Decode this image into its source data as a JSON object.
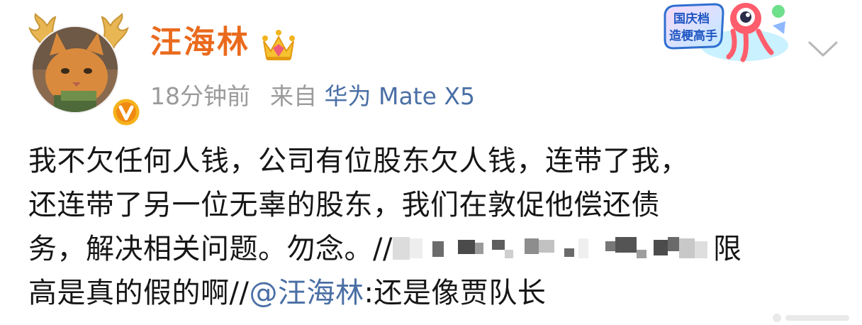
{
  "post": {
    "user_name": "汪海林",
    "time": "18分钟前",
    "source_prefix": "来自",
    "device": "华为 Mate X5",
    "body": {
      "line1": "我不欠任何人钱，公司有位股东欠人钱，连带了我，",
      "line2": "还连带了另一位无辜的股东，我们在敦促他偿还债",
      "line3_a": "务，解决相关问题。勿念。//",
      "line3_b": "限",
      "line4_a": "高是真的假的啊//",
      "line4_mention": "@汪海林",
      "line4_b": ":还是像贾队长"
    }
  },
  "badges": {
    "holiday_line1": "国庆档",
    "holiday_line2": "造梗高手"
  },
  "icons": {
    "avatar": "orange-cat-avatar",
    "antlers": "deer-antlers-decoration",
    "verified": "gold-v-verified-icon",
    "crown": "member-crown-icon",
    "collapse": "chevron-down-icon",
    "mosaic": "redacted-mosaic"
  },
  "colors": {
    "name": "#ea6a1d",
    "link": "#4a6fa5",
    "meta": "#9b9b9b",
    "text": "#161616"
  }
}
